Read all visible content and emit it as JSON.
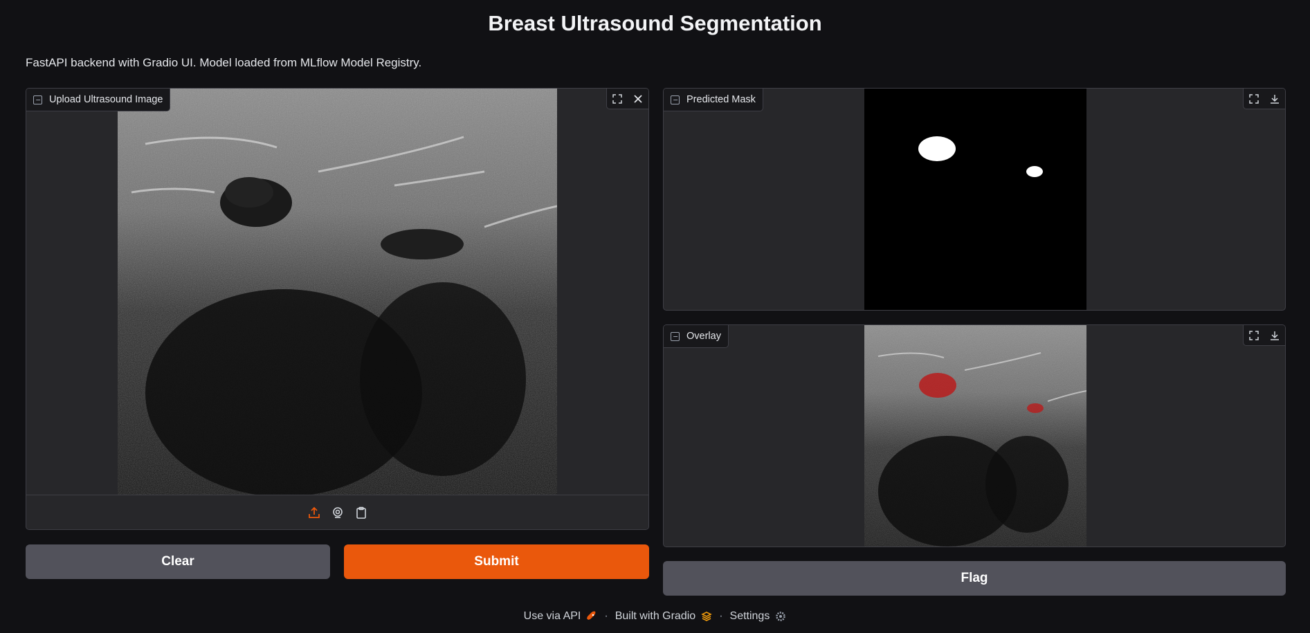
{
  "header": {
    "title": "Breast Ultrasound Segmentation",
    "description": "FastAPI backend with Gradio UI. Model loaded from MLflow Model Registry."
  },
  "input_panel": {
    "label": "Upload Ultrasound Image",
    "icons": [
      "fullscreen-icon",
      "close-icon"
    ],
    "sources": [
      "upload-icon",
      "webcam-icon",
      "clipboard-icon"
    ],
    "active_source_color": "#ea580c"
  },
  "mask_panel": {
    "label": "Predicted Mask",
    "icons": [
      "fullscreen-icon",
      "download-icon"
    ]
  },
  "overlay_panel": {
    "label": "Overlay",
    "icons": [
      "fullscreen-icon",
      "download-icon"
    ]
  },
  "buttons": {
    "clear": "Clear",
    "submit": "Submit",
    "flag": "Flag"
  },
  "footer": {
    "api": "Use via API",
    "built": "Built with Gradio",
    "settings": "Settings",
    "separator": "·"
  },
  "colors": {
    "primary": "#ea580c",
    "secondary": "#52525b",
    "panel_bg": "#27272a",
    "page_bg": "#111114"
  }
}
